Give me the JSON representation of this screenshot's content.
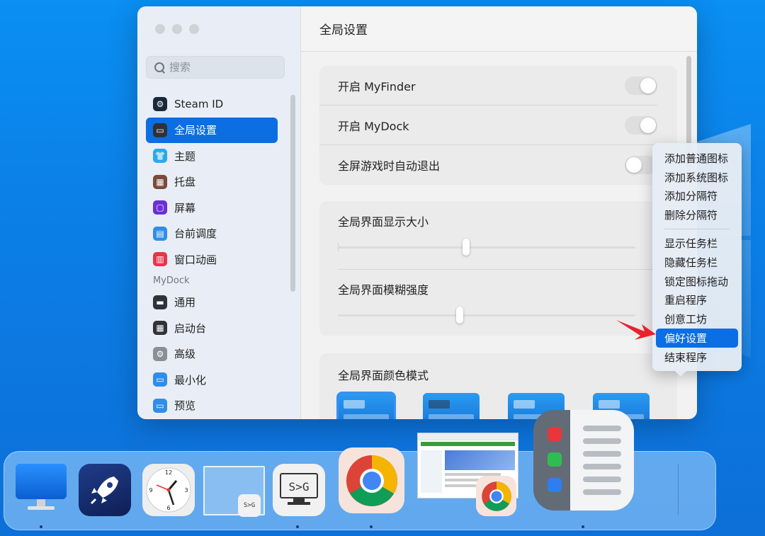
{
  "window": {
    "title": "全局设置",
    "search_placeholder": "搜索"
  },
  "sidebar": {
    "items": [
      {
        "label": "Steam ID",
        "icon": "steam-icon",
        "color": "#1b2838"
      },
      {
        "label": "全局设置",
        "icon": "window-icon",
        "color": "#2f3238",
        "active": true
      },
      {
        "label": "主题",
        "icon": "shirt-icon",
        "color": "#2aa8f0"
      },
      {
        "label": "托盘",
        "icon": "grid-icon",
        "color": "#7a4a3a"
      },
      {
        "label": "屏幕",
        "icon": "screen-icon",
        "color": "#6a2fd6"
      },
      {
        "label": "台前调度",
        "icon": "stage-icon",
        "color": "#2f8ee8"
      },
      {
        "label": "窗口动画",
        "icon": "animation-icon",
        "color": "#e8344b"
      }
    ],
    "section_label": "MyDock",
    "dock_items": [
      {
        "label": "通用",
        "icon": "general-icon",
        "color": "#2f3238"
      },
      {
        "label": "启动台",
        "icon": "launchpad-icon",
        "color": "#2f3238"
      },
      {
        "label": "高级",
        "icon": "gear-icon",
        "color": "#8b8f95"
      },
      {
        "label": "最小化",
        "icon": "minimize-icon",
        "color": "#2f8ee8"
      },
      {
        "label": "预览",
        "icon": "preview-icon",
        "color": "#2f8ee8"
      }
    ]
  },
  "settings": {
    "toggles": [
      {
        "label": "开启 MyFinder",
        "on": true
      },
      {
        "label": "开启 MyDock",
        "on": true
      },
      {
        "label": "全屏游戏时自动退出",
        "on": false
      }
    ],
    "sliders": [
      {
        "label": "全局界面显示大小",
        "value": 0.43
      },
      {
        "label": "全局界面模糊强度",
        "value": 0.41
      }
    ],
    "color_mode": {
      "label": "全局界面颜色模式",
      "selected_index": 0
    }
  },
  "context_menu": {
    "group1": [
      "添加普通图标",
      "添加系统图标",
      "添加分隔符",
      "删除分隔符"
    ],
    "group2": [
      "显示任务栏",
      "隐藏任务栏",
      "锁定图标拖动",
      "重启程序",
      "创意工坊",
      "偏好设置",
      "结束程序"
    ],
    "active_label": "偏好设置"
  },
  "dock": {
    "sg_label": "S>G"
  },
  "colors": {
    "accent": "#0b6ee3",
    "arrow": "#e8232e"
  }
}
